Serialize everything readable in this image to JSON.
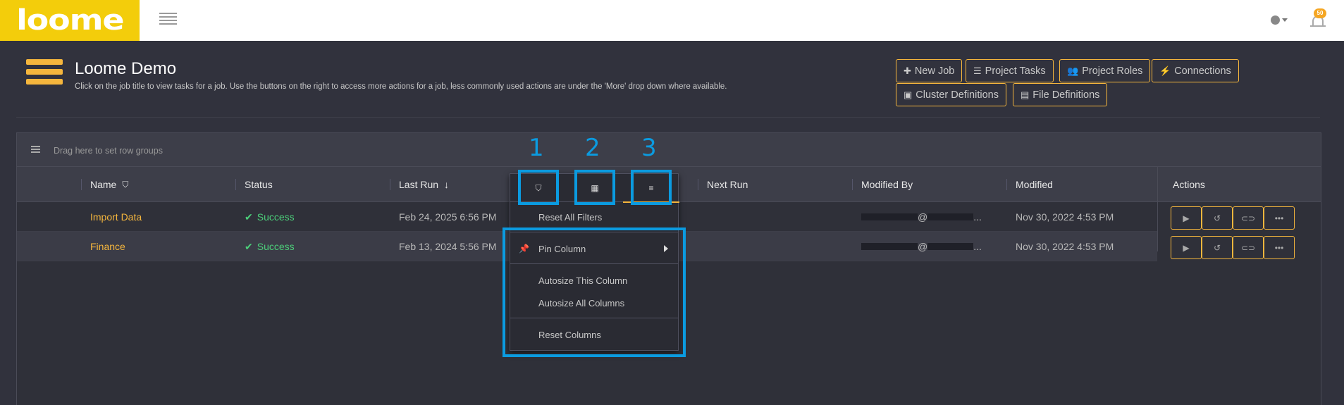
{
  "app": {
    "logo_text": "loome",
    "notification_count": "50"
  },
  "page": {
    "title": "Loome Demo",
    "description": "Click on the job title to view tasks for a job. Use the buttons on the right to access more actions for a job, less commonly used actions are under the 'More' drop down where available."
  },
  "header_buttons": {
    "new_job": "New Job",
    "project_tasks": "Project Tasks",
    "project_roles": "Project Roles",
    "connections": "Connections",
    "cluster_definitions": "Cluster Definitions",
    "file_definitions": "File Definitions"
  },
  "grid": {
    "group_placeholder": "Drag here to set row groups",
    "columns": {
      "name": "Name",
      "status": "Status",
      "last_run": "Last Run",
      "next_run": "Next Run",
      "modified_by": "Modified By",
      "modified": "Modified",
      "actions": "Actions"
    },
    "rows": [
      {
        "name": "Import Data",
        "status": "Success",
        "last_run": "Feb 24, 2025 6:56 PM",
        "next_run": "",
        "modified_by_at": "@",
        "modified_by_tail": "...",
        "modified": "Nov 30, 2022 4:53 PM"
      },
      {
        "name": "Finance",
        "status": "Success",
        "last_run": "Feb 13, 2024 5:56 PM",
        "next_run": "",
        "modified_by_at": "@",
        "modified_by_tail": "...",
        "modified": "Nov 30, 2022 4:53 PM"
      }
    ],
    "action_buttons": [
      "play-icon",
      "history-icon",
      "toggle-icon",
      "more-icon"
    ]
  },
  "column_menu": {
    "tabs": [
      "filter-icon",
      "columns-icon",
      "menu-icon"
    ],
    "items": {
      "reset_filters": "Reset All Filters",
      "pin_column": "Pin Column",
      "autosize_this": "Autosize This Column",
      "autosize_all": "Autosize All Columns",
      "reset_columns": "Reset Columns"
    }
  },
  "annotations": [
    "1",
    "2",
    "3"
  ],
  "colors": {
    "accent": "#f5b63d",
    "logo_bg": "#f3cd0b",
    "success": "#4ccf7a",
    "highlight": "#0b9be0",
    "background": "#31323d"
  }
}
